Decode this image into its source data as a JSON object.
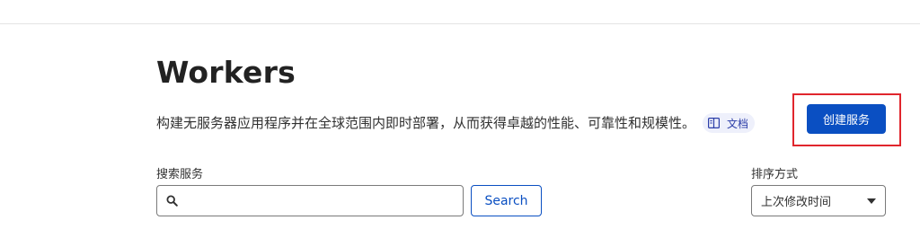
{
  "header": {
    "title": "Workers",
    "description": "构建无服务器应用程序并在全球范围内即时部署，从而获得卓越的性能、可靠性和规模性。",
    "docs_label": "文档"
  },
  "actions": {
    "create_service_label": "创建服务"
  },
  "search": {
    "label": "搜索服务",
    "value": "",
    "placeholder": "",
    "button_label": "Search"
  },
  "sort": {
    "label": "排序方式",
    "selected": "上次修改时间"
  },
  "colors": {
    "accent": "#0a4fc2",
    "highlight": "#e0262d",
    "docs_badge_bg": "#eef0fb"
  }
}
